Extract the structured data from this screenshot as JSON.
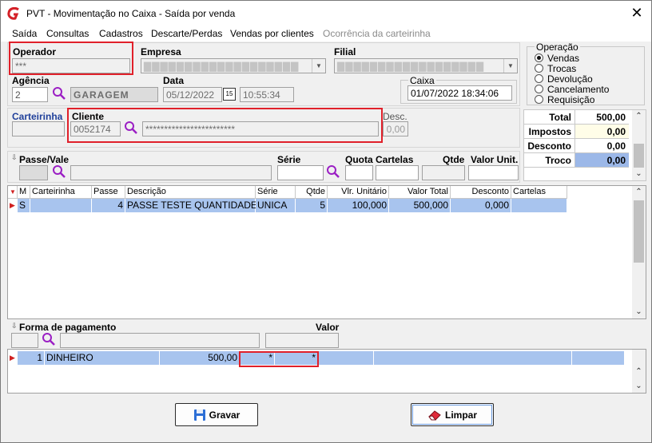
{
  "window": {
    "title": "PVT - Movimentação no Caixa - Saída por venda"
  },
  "menu": [
    {
      "label": "Saída",
      "disabled": false
    },
    {
      "label": "Consultas",
      "disabled": false
    },
    {
      "label": "Cadastros",
      "disabled": false
    },
    {
      "label": "Descarte/Perdas",
      "disabled": false
    },
    {
      "label": "Vendas por clientes",
      "disabled": false
    },
    {
      "label": "Ocorrência da carteirinha",
      "disabled": true
    }
  ],
  "operador": {
    "label": "Operador",
    "value": "***"
  },
  "empresa": {
    "label": "Empresa"
  },
  "filial": {
    "label": "Filial"
  },
  "operacao": {
    "label": "Operação",
    "options": [
      "Vendas",
      "Trocas",
      "Devolução",
      "Cancelamento",
      "Requisição"
    ],
    "selected": "Vendas"
  },
  "agencia": {
    "label": "Agência",
    "code": "2",
    "name": "GARAGEM"
  },
  "data": {
    "label": "Data",
    "date": "05/12/2022",
    "calendar_label": "15",
    "time": "10:55:34"
  },
  "caixa": {
    "label": "Caixa",
    "value": "01/07/2022 18:34:06"
  },
  "carteirinha": {
    "label": "Carteirinha"
  },
  "cliente": {
    "label": "Cliente",
    "code": "0052174",
    "name": "************************"
  },
  "desc": {
    "label": "Desc.",
    "value": "0,00"
  },
  "totals": [
    {
      "label": "Total",
      "value": "500,00"
    },
    {
      "label": "Impostos",
      "value": "0,00"
    },
    {
      "label": "Desconto",
      "value": "0,00"
    },
    {
      "label": "Troco",
      "value": "0,00"
    }
  ],
  "passe": {
    "label": "Passe/Vale",
    "serie_label": "Série",
    "quota_label": "Quota",
    "cartelas_label": "Cartelas",
    "qtde_label": "Qtde",
    "valor_label": "Valor Unit."
  },
  "items_table": {
    "columns": [
      "M",
      "Carteirinha",
      "Passe",
      "Descrição",
      "Série",
      "Qtde",
      "Vlr. Unitário",
      "Valor Total",
      "Desconto",
      "Cartelas"
    ],
    "rows": [
      {
        "m": "S",
        "carteirinha": "",
        "passe": "4",
        "descricao": "PASSE TESTE QUANTIDADE",
        "serie": "UNICA",
        "qtde": "5",
        "vlr_unitario": "100,000",
        "valor_total": "500,000",
        "desconto": "0,000",
        "cartelas": ""
      }
    ]
  },
  "pagamento": {
    "label": "Forma de pagamento",
    "valor_label": "Valor",
    "rows": [
      {
        "num": "1",
        "forma": "DINHEIRO",
        "valor": "500,00",
        "c1": "*",
        "c2": "*"
      }
    ]
  },
  "buttons": {
    "gravar": "Gravar",
    "limpar": "Limpar"
  },
  "colors": {
    "highlight_row": "#a8c4ee",
    "red_frame": "#e0202a",
    "accent_purple": "#9b1fc4",
    "troco_bg": "#9cb8e8"
  }
}
